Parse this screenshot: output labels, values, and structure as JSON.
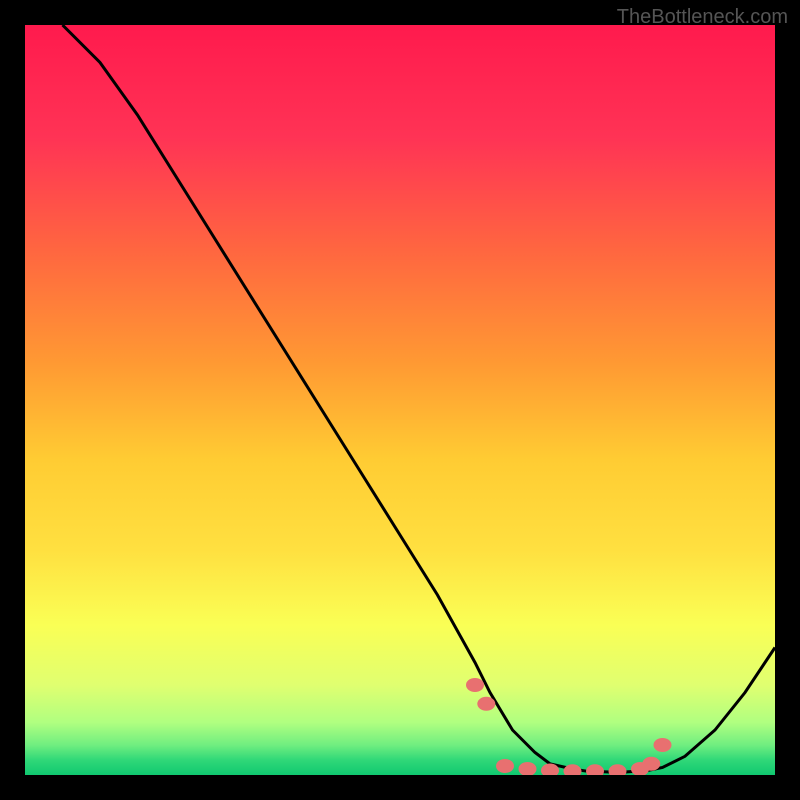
{
  "watermark": "TheBottleneck.com",
  "chart_data": {
    "type": "line",
    "title": "",
    "xlabel": "",
    "ylabel": "",
    "xlim": [
      0,
      100
    ],
    "ylim": [
      0,
      100
    ],
    "series": [
      {
        "name": "curve",
        "x": [
          5,
          10,
          15,
          20,
          25,
          30,
          35,
          40,
          45,
          50,
          55,
          60,
          62,
          65,
          68,
          70,
          73,
          75,
          78,
          80,
          83,
          85,
          88,
          92,
          96,
          100
        ],
        "y": [
          100,
          95,
          88,
          80,
          72,
          64,
          56,
          48,
          40,
          32,
          24,
          15,
          11,
          6,
          3,
          1.5,
          0.8,
          0.5,
          0.4,
          0.4,
          0.6,
          1.0,
          2.5,
          6,
          11,
          17
        ]
      }
    ],
    "markers": {
      "name": "dots",
      "x": [
        60,
        61.5,
        64,
        67,
        70,
        73,
        76,
        79,
        82,
        83.5,
        85
      ],
      "y": [
        12,
        9.5,
        1.2,
        0.8,
        0.6,
        0.5,
        0.5,
        0.5,
        0.8,
        1.5,
        4
      ]
    },
    "gradient_stops": [
      {
        "offset": 0,
        "color": "#ff1a4d"
      },
      {
        "offset": 15,
        "color": "#ff3355"
      },
      {
        "offset": 30,
        "color": "#ff6640"
      },
      {
        "offset": 45,
        "color": "#ff9933"
      },
      {
        "offset": 58,
        "color": "#ffcc33"
      },
      {
        "offset": 70,
        "color": "#ffe040"
      },
      {
        "offset": 80,
        "color": "#faff55"
      },
      {
        "offset": 88,
        "color": "#e0ff70"
      },
      {
        "offset": 93,
        "color": "#b0ff80"
      },
      {
        "offset": 96,
        "color": "#70ee80"
      },
      {
        "offset": 98,
        "color": "#30d878"
      },
      {
        "offset": 100,
        "color": "#10c870"
      }
    ]
  }
}
